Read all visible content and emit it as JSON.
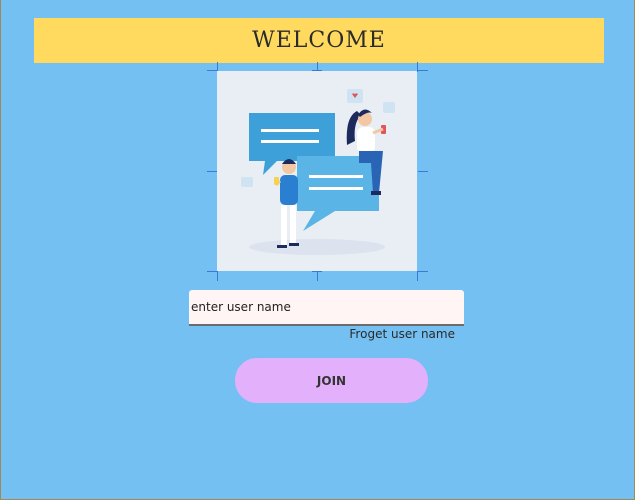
{
  "header": {
    "title": "WELCOME"
  },
  "hero": {
    "illustration": "chat-people-illustration"
  },
  "form": {
    "username_placeholder": "enter user name",
    "username_value": "",
    "forgot_label": "Froget user name",
    "join_label": "JOIN"
  },
  "colors": {
    "background": "#75c0f2",
    "banner": "#ffda5e",
    "button": "#e3b0fb",
    "input": "#fff5f4",
    "selection_handles": "#3a79d6"
  }
}
